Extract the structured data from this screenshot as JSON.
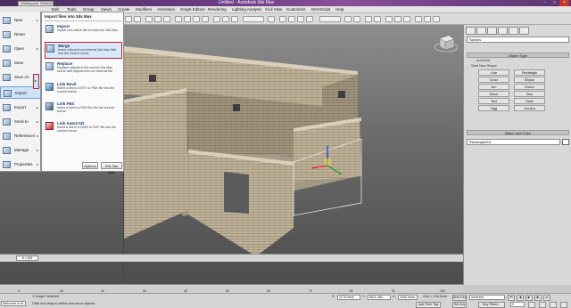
{
  "window": {
    "workspace": "Workspace: Default",
    "title": "Untitled - Autodesk 3ds Max"
  },
  "menubar": [
    "Edit",
    "Tools",
    "Group",
    "Views",
    "Create",
    "Modifiers",
    "Animation",
    "Graph Editors",
    "Rendering",
    "Lighting Analysis",
    "Civil View",
    "Customize",
    "MAXScript",
    "Help"
  ],
  "app_menu": {
    "items": [
      {
        "label": "New",
        "arrow": "▸"
      },
      {
        "label": "Reset",
        "arrow": ""
      },
      {
        "label": "Open",
        "arrow": "▸"
      },
      {
        "label": "Save",
        "arrow": ""
      },
      {
        "label": "Save As",
        "arrow": "▸"
      },
      {
        "label": "Import",
        "arrow": "▸"
      },
      {
        "label": "Export",
        "arrow": "▸"
      },
      {
        "label": "Send to",
        "arrow": "▸"
      },
      {
        "label": "References",
        "arrow": "▸"
      },
      {
        "label": "Manage",
        "arrow": "▸"
      },
      {
        "label": "Properties",
        "arrow": "▸"
      }
    ]
  },
  "import_flyout": {
    "heading": "Import files into 3ds Max",
    "options": [
      {
        "title": "Import",
        "desc": "Import non-native file formats into 3ds Max."
      },
      {
        "title": "Merge",
        "desc": "Insert objects from external 3ds Max files into the current scene."
      },
      {
        "title": "Replace",
        "desc": "Replace objects in the current 3ds Max scene with objects from an external file."
      },
      {
        "title": "Link Revit",
        "desc": "Insert a link to a RVT or FBX file into the current scene."
      },
      {
        "title": "Link FBX",
        "desc": "Insert a link to a FBX file into the current scene."
      },
      {
        "title": "Link AutoCAD",
        "desc": "Insert a link to a DWG or DXF file into the current scene."
      }
    ],
    "options_button": "Options",
    "exit_button": "Exit 3ds Max"
  },
  "command_panel": {
    "category": "Splines",
    "object_type_header": "Object Type",
    "autogrid": "AutoGrid",
    "start_new_shape": "Start New Shape",
    "buttons": [
      "Line",
      "Rectangle",
      "Circle",
      "Ellipse",
      "Arc",
      "Donut",
      "NGon",
      "Star",
      "Text",
      "Helix",
      "Egg",
      "Section"
    ],
    "name_color_header": "Name and Color",
    "object_name": "Rectangle001"
  },
  "time_slider": {
    "label": "0 / 100"
  },
  "trackbar": {
    "ticks": [
      "0",
      "10",
      "20",
      "30",
      "40",
      "50",
      "60",
      "70",
      "80",
      "90",
      "100"
    ]
  },
  "status": {
    "selection": "1 Shape Selected",
    "prompt": "Click and drag to select and move objects",
    "maxscript": "Welcome to M",
    "x": "1178.0mm",
    "y": "9611.460",
    "z": "1000.0mm",
    "grid": "Grid = 100.0mm",
    "add_time_tag": "Add Time Tag",
    "auto_key": "Auto Key",
    "selected": "Selected",
    "set_key": "Set Key",
    "key_filters": "Key Filters...",
    "frame": "0"
  },
  "colors": {
    "highlight_border": "#cc1f2f",
    "title_bar": "#6f3c86"
  }
}
